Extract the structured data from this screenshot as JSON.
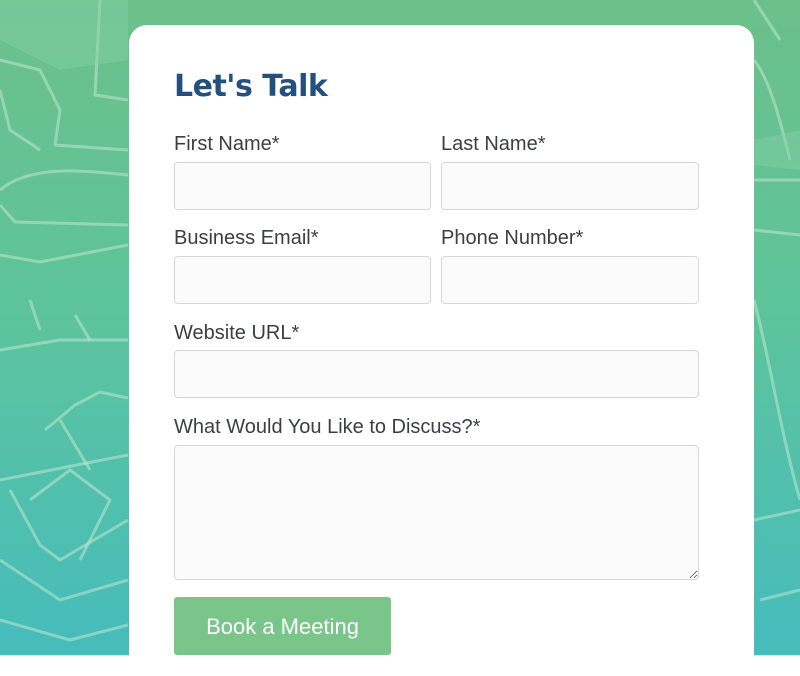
{
  "form": {
    "title": "Let's Talk",
    "fields": {
      "first_name": {
        "label": "First Name*",
        "value": "",
        "placeholder": ""
      },
      "last_name": {
        "label": "Last Name*",
        "value": "",
        "placeholder": ""
      },
      "business_email": {
        "label": "Business Email*",
        "value": "",
        "placeholder": ""
      },
      "phone_number": {
        "label": "Phone Number*",
        "value": "",
        "placeholder": ""
      },
      "website_url": {
        "label": "Website URL*",
        "value": "",
        "placeholder": ""
      },
      "discuss": {
        "label": "What Would You Like to Discuss?*",
        "value": "",
        "placeholder": ""
      }
    },
    "submit_label": "Book a Meeting"
  },
  "colors": {
    "title": "#24507f",
    "button": "#79c58a",
    "background_top": "#6cc08a",
    "background_bottom": "#46bcbc"
  }
}
